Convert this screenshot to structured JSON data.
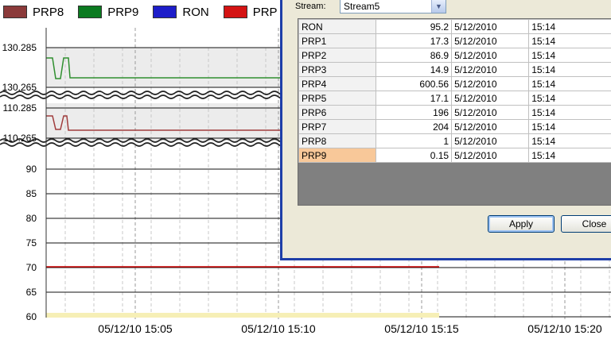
{
  "chart_data": {
    "type": "line",
    "legend": [
      "PRP8",
      "PRP9",
      "RON",
      "PRP"
    ],
    "y_tick_labels": [
      "130.285",
      "130.265",
      "110.285",
      "110.265",
      "90",
      "85",
      "80",
      "75",
      "70",
      "65",
      "60"
    ],
    "x_tick_labels": [
      "05/12/10 15:05",
      "05/12/10 15:10",
      "05/12/10 15:15",
      "05/12/10 15:20"
    ],
    "series": [
      {
        "name": "PRP8",
        "color": "#993333"
      },
      {
        "name": "PRP9",
        "color": "#009933"
      },
      {
        "name": "RON",
        "color": "#0000cc"
      },
      {
        "name": "PRP",
        "color": "#cc0000"
      }
    ],
    "grid": true
  },
  "legend_colors": {
    "PRP8": "#8b3a3a",
    "PRP9": "#0b7a20",
    "RON": "#1d1dc9",
    "PRP": "#d41313"
  },
  "dialog": {
    "stream_label": "Stream:",
    "stream_value": "Stream5",
    "rows": [
      {
        "name": "RON",
        "value": "95.2",
        "date": "5/12/2010",
        "time": "15:14"
      },
      {
        "name": "PRP1",
        "value": "17.3",
        "date": "5/12/2010",
        "time": "15:14"
      },
      {
        "name": "PRP2",
        "value": "86.9",
        "date": "5/12/2010",
        "time": "15:14"
      },
      {
        "name": "PRP3",
        "value": "14.9",
        "date": "5/12/2010",
        "time": "15:14"
      },
      {
        "name": "PRP4",
        "value": "600.56",
        "date": "5/12/2010",
        "time": "15:14"
      },
      {
        "name": "PRP5",
        "value": "17.1",
        "date": "5/12/2010",
        "time": "15:14"
      },
      {
        "name": "PRP6",
        "value": "196",
        "date": "5/12/2010",
        "time": "15:14"
      },
      {
        "name": "PRP7",
        "value": "204",
        "date": "5/12/2010",
        "time": "15:14"
      },
      {
        "name": "PRP8",
        "value": "1",
        "date": "5/12/2010",
        "time": "15:14"
      },
      {
        "name": "PRP9",
        "value": "0.15",
        "date": "5/12/2010",
        "time": "15:14"
      }
    ],
    "selected_row": "PRP9",
    "apply_label": "Apply",
    "close_label": "Close"
  }
}
